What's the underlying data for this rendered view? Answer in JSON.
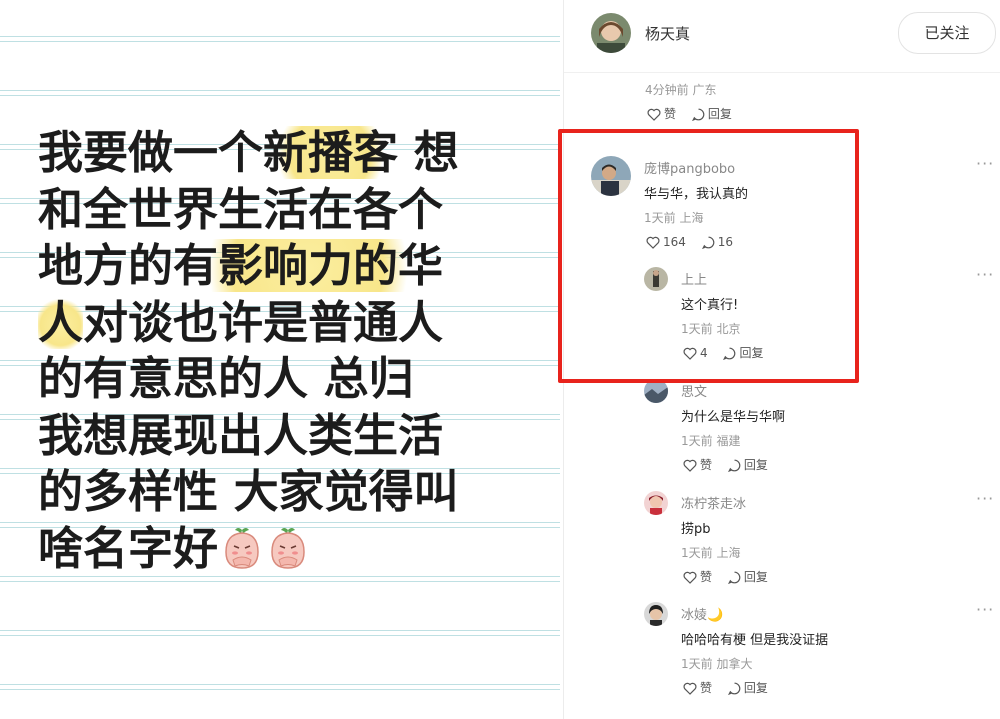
{
  "post": {
    "lines": [
      [
        {
          "t": "我要做一个",
          "hl": false
        },
        {
          "t": "新播客",
          "hl": true
        },
        {
          "t": " 想",
          "hl": false
        }
      ],
      [
        {
          "t": "和全世界生活在各个",
          "hl": false
        }
      ],
      [
        {
          "t": "地方的",
          "hl": false
        },
        {
          "t": "有影响力的华",
          "hl": true
        }
      ],
      [
        {
          "t": "人",
          "hl": true
        },
        {
          "t": "对谈也许是普通人",
          "hl": false
        }
      ],
      [
        {
          "t": "的有意思的人 总归",
          "hl": false
        }
      ],
      [
        {
          "t": "我想展现出人类生活",
          "hl": false
        }
      ],
      [
        {
          "t": "的多样性 大家觉得叫",
          "hl": false
        }
      ],
      [
        {
          "t": "啥名字好",
          "hl": false
        }
      ]
    ]
  },
  "author": {
    "name": "杨天真",
    "follow_label": "已关注"
  },
  "top_meta": {
    "time": "4分钟前",
    "location": "广东",
    "like_label": "赞",
    "reply_label": "回复"
  },
  "comments": [
    {
      "user": "庞博pangbobo",
      "text": "华与华，我认真的",
      "time": "1天前",
      "location": "上海",
      "likes": "164",
      "replies": "16",
      "more": "···",
      "reply": {
        "user": "上上",
        "text": "这个真行!",
        "time": "1天前",
        "location": "北京",
        "likes": "4",
        "reply_label": "回复",
        "more": "···"
      }
    }
  ],
  "sub_comments": [
    {
      "user": "思文",
      "text": "为什么是华与华啊",
      "time": "1天前",
      "location": "福建",
      "like_label": "赞",
      "reply_label": "回复"
    },
    {
      "user": "冻柠茶走冰",
      "text": "捞pb",
      "time": "1天前",
      "location": "上海",
      "like_label": "赞",
      "reply_label": "回复",
      "more": "···"
    },
    {
      "user": "冰婈🌙",
      "text": "哈哈哈有梗 但是我没证据",
      "time": "1天前",
      "location": "加拿大",
      "like_label": "赞",
      "reply_label": "回复",
      "more": "···"
    }
  ],
  "colors": {
    "highlight": "#f8e68a",
    "red_box": "#e8231c",
    "ruled_line": "#bfe0e3"
  }
}
